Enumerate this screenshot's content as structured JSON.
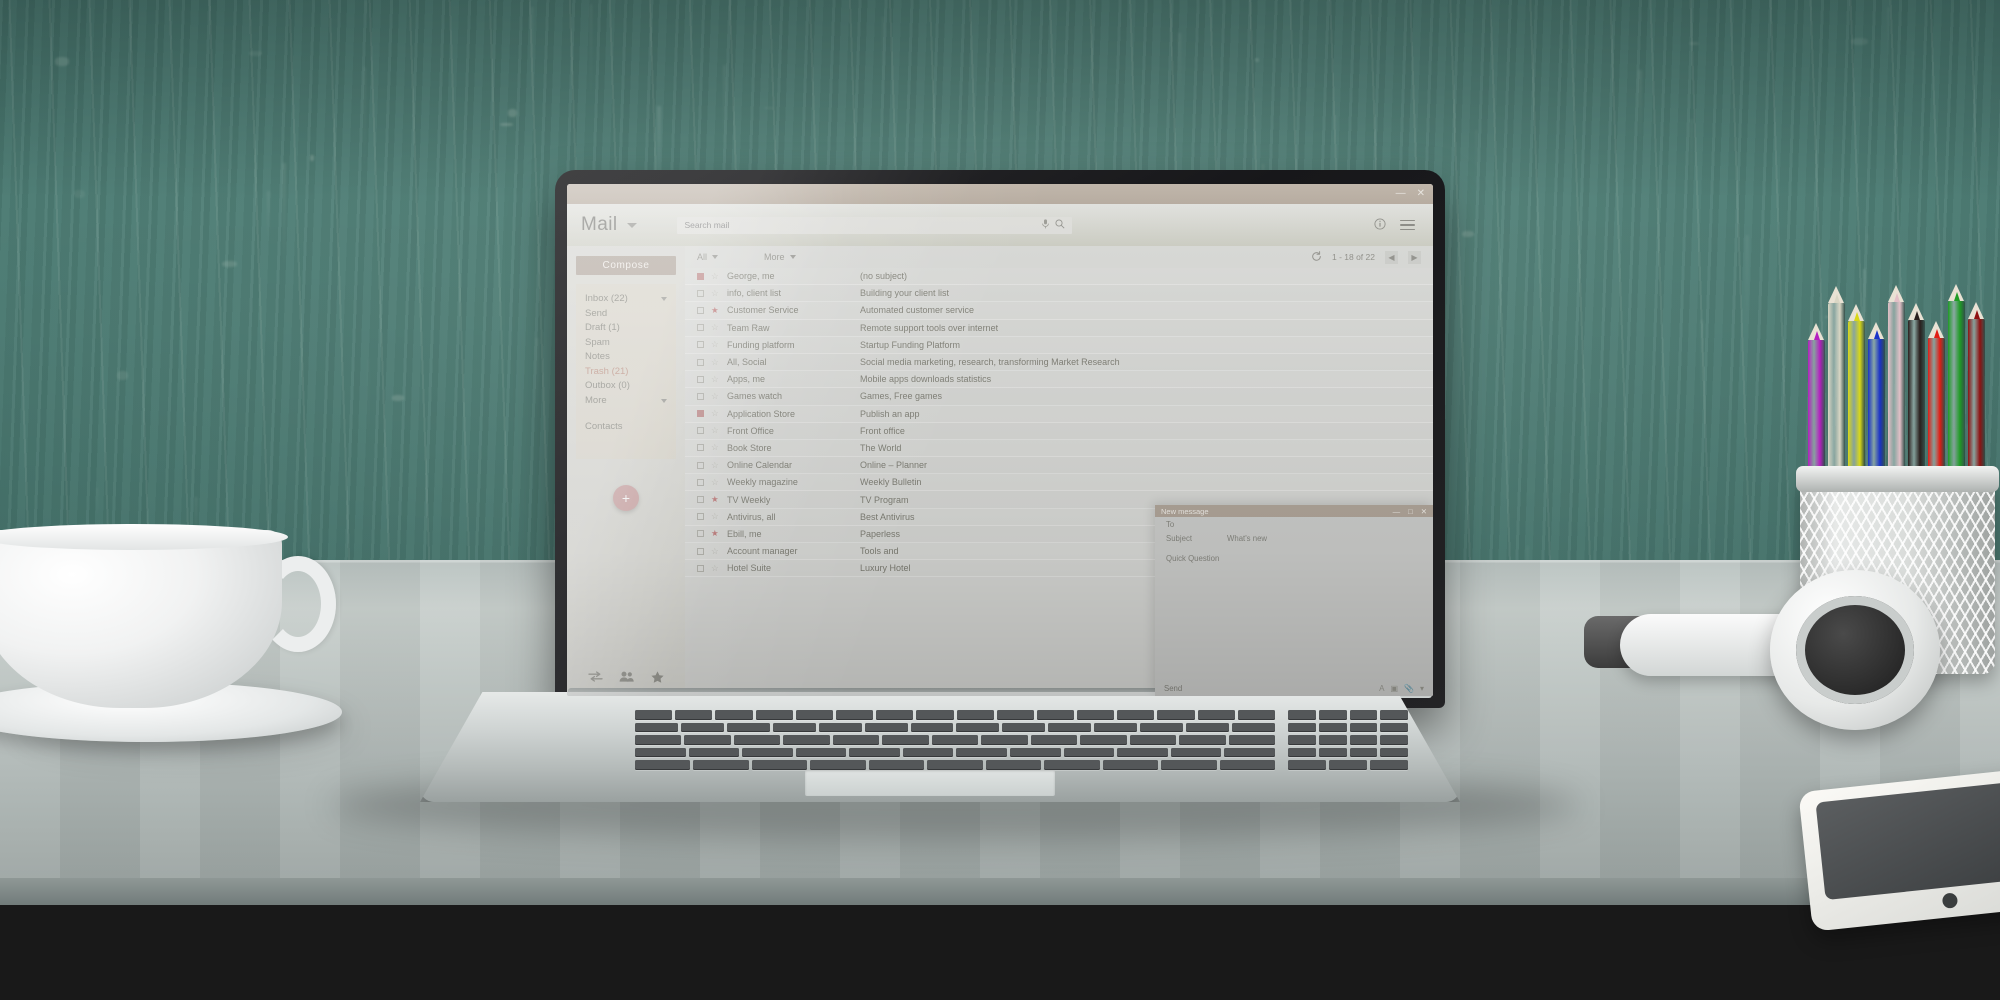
{
  "scene": {
    "description": "Laptop on a wooden desk against a weathered teal wall, with a white coffee cup and saucer at left, colored pencils in a wire mesh holder, white headphones and a white smartphone at right",
    "wall_color": "#4b7a72",
    "desk_color": "#b9c2c0",
    "floor_color": "#191919"
  },
  "window": {
    "minimize_label": "—",
    "close_label": "✕"
  },
  "header": {
    "brand": "Mail",
    "brand_caret": "chevron-down-icon",
    "search_placeholder": "Search mail",
    "search_value": "",
    "mic_icon": "microphone-icon",
    "search_icon": "search-icon",
    "info_icon": "info-icon",
    "menu_icon": "hamburger-menu-icon"
  },
  "sidebar": {
    "compose_label": "Compose",
    "folders": [
      {
        "label": "Inbox (22)",
        "caret": true,
        "alert": false
      },
      {
        "label": "Send",
        "caret": false,
        "alert": false
      },
      {
        "label": "Draft (1)",
        "caret": false,
        "alert": false
      },
      {
        "label": "Spam",
        "caret": false,
        "alert": false
      },
      {
        "label": "Notes",
        "caret": false,
        "alert": false
      },
      {
        "label": "Trash (21)",
        "caret": false,
        "alert": true
      },
      {
        "label": "Outbox (0)",
        "caret": false,
        "alert": false
      },
      {
        "label": "More",
        "caret": true,
        "alert": false
      },
      {
        "label": "Contacts",
        "caret": false,
        "alert": false,
        "gap": true
      }
    ],
    "fab_label": "+",
    "fab_color": "#c89b9b",
    "bottom_icons": [
      {
        "name": "transfer-arrows-icon",
        "glyph": "⇄"
      },
      {
        "name": "contacts-people-icon",
        "glyph": "👥"
      },
      {
        "name": "starred-icon",
        "glyph": "★"
      }
    ]
  },
  "list_toolbar": {
    "select_all_label": "All",
    "more_label": "More",
    "refresh_icon": "refresh-icon",
    "pagination": "1 - 18 of 22",
    "prev_label": "◀",
    "next_label": "▶"
  },
  "emails": [
    {
      "checked": true,
      "starred": false,
      "sender": "George, me",
      "subject": "(no subject)"
    },
    {
      "checked": false,
      "starred": false,
      "sender": "info, client list",
      "subject": "Building your client list"
    },
    {
      "checked": false,
      "starred": true,
      "sender": "Customer Service",
      "subject": "Automated customer service"
    },
    {
      "checked": false,
      "starred": false,
      "sender": "Team Raw",
      "subject": "Remote support tools over internet"
    },
    {
      "checked": false,
      "starred": false,
      "sender": "Funding platform",
      "subject": "Startup Funding Platform"
    },
    {
      "checked": false,
      "starred": false,
      "sender": "All, Social",
      "subject": "Social media marketing, research, transforming Market Research"
    },
    {
      "checked": false,
      "starred": false,
      "sender": "Apps, me",
      "subject": "Mobile apps downloads statistics"
    },
    {
      "checked": false,
      "starred": false,
      "sender": "Games watch",
      "subject": "Games, Free games"
    },
    {
      "checked": true,
      "starred": false,
      "sender": "Application Store",
      "subject": "Publish an app"
    },
    {
      "checked": false,
      "starred": false,
      "sender": "Front Office",
      "subject": "Front office"
    },
    {
      "checked": false,
      "starred": false,
      "sender": "Book Store",
      "subject": "The World"
    },
    {
      "checked": false,
      "starred": false,
      "sender": "Online Calendar",
      "subject": "Online – Planner"
    },
    {
      "checked": false,
      "starred": false,
      "sender": "Weekly magazine",
      "subject": "Weekly Bulletin"
    },
    {
      "checked": false,
      "starred": true,
      "sender": "TV Weekly",
      "subject": "TV Program"
    },
    {
      "checked": false,
      "starred": false,
      "sender": "Antivirus, all",
      "subject": "Best Antivirus"
    },
    {
      "checked": false,
      "starred": true,
      "sender": "Ebill, me",
      "subject": "Paperless"
    },
    {
      "checked": false,
      "starred": false,
      "sender": "Account manager",
      "subject": "Tools and"
    },
    {
      "checked": false,
      "starred": false,
      "sender": "Hotel Suite",
      "subject": "Luxury Hotel"
    }
  ],
  "compose_popup": {
    "title": "New message",
    "minimize_label": "—",
    "maximize_label": "□",
    "close_label": "✕",
    "to_label": "To",
    "to_value": "",
    "subject_label": "Subject",
    "subject_value": "What's new",
    "body_value": "Quick Question",
    "send_label": "Send",
    "tools": [
      {
        "name": "format-text-icon",
        "glyph": "A"
      },
      {
        "name": "insert-image-icon",
        "glyph": "▣"
      },
      {
        "name": "attach-file-icon",
        "glyph": "📎"
      },
      {
        "name": "more-options-icon",
        "glyph": "▾"
      }
    ]
  },
  "pencil_colors": [
    "#b41fbf",
    "#d9d6c4",
    "#d8d716",
    "#1a32c8",
    "#e2bfc6",
    "#2a1f1d",
    "#e01d14",
    "#1f9c25",
    "#8f1111"
  ]
}
